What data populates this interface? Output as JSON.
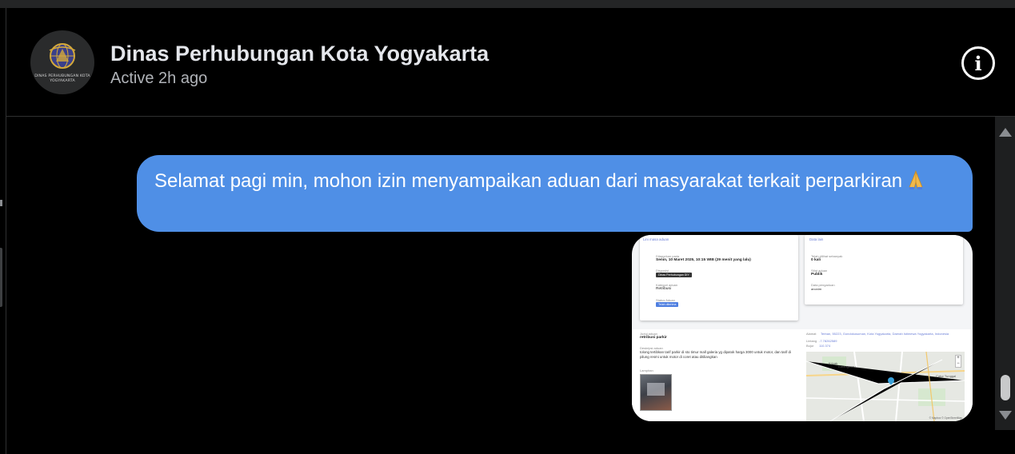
{
  "header": {
    "title": "Dinas Perhubungan Kota Yogyakarta",
    "status": "Active 2h ago",
    "avatar_text": "DINAS PERHUBUNGAN KOTA YOGYAKARTA",
    "info_icon": "info-icon"
  },
  "messages": [
    {
      "type": "text",
      "text": "Selamat pagi min, mohon izin menyampaikan aduan dari masyarakat terkait perparkiran",
      "emoji": "folded-hands"
    },
    {
      "type": "image",
      "image": {
        "card_left": {
          "heading": "Lini masa aduan",
          "date_label": "Dilaporkan pada",
          "date_value": "Senin, 10 Maret 2025, 10:15 WIB (29 menit yang lalu)",
          "dispo_label": "Disposisi",
          "dispo_tag": "Dinas Perhubungan DIY",
          "category_label": "Kategori aduan",
          "category_value": "Retribusi",
          "status_label": "Status Aduan",
          "status_tag": "Telah diterima"
        },
        "card_right": {
          "heading": "Data lain",
          "seen_label": "Telah dilihat sebanyak",
          "seen_value": "0 kali",
          "sifat_label": "Sifat aduan",
          "sifat_value": "Publik",
          "reporter_label": "Data pengaduan",
          "reporter_value": "anonim"
        },
        "lower": {
          "title_label": "Judul aduan",
          "title_value": "retribusi parkir",
          "desc_label": "Deskripsi aduan",
          "desc_value": "tolong tertibkan tarif parkir di sto timur mall galeria yg dipatok harga 3000 untuk motor, dan tarif di pilung resmi untuk motor di coret atau ditiliangkan",
          "attach_label": "Lampiran",
          "address_label": "Alamat",
          "address_value": "Terban, 55223, Gondokusuman, Kota Yogyakarta, Daerah Istimewa Yogyakarta, Indonesia",
          "lat_label": "Lintang",
          "lat_value": "-7.78262589",
          "lng_label": "Bujur",
          "lng_value": "110.374",
          "map_labels": [
            "Kricak",
            "Karangwaru",
            "Catur Tunggal"
          ],
          "map_copyright": "© Mapbox © OpenStreetMap"
        }
      }
    }
  ],
  "colors": {
    "background": "#000000",
    "bubble": "#4f8fe6",
    "header_text": "#e4e6eb",
    "status_text": "#b0b3b8"
  }
}
